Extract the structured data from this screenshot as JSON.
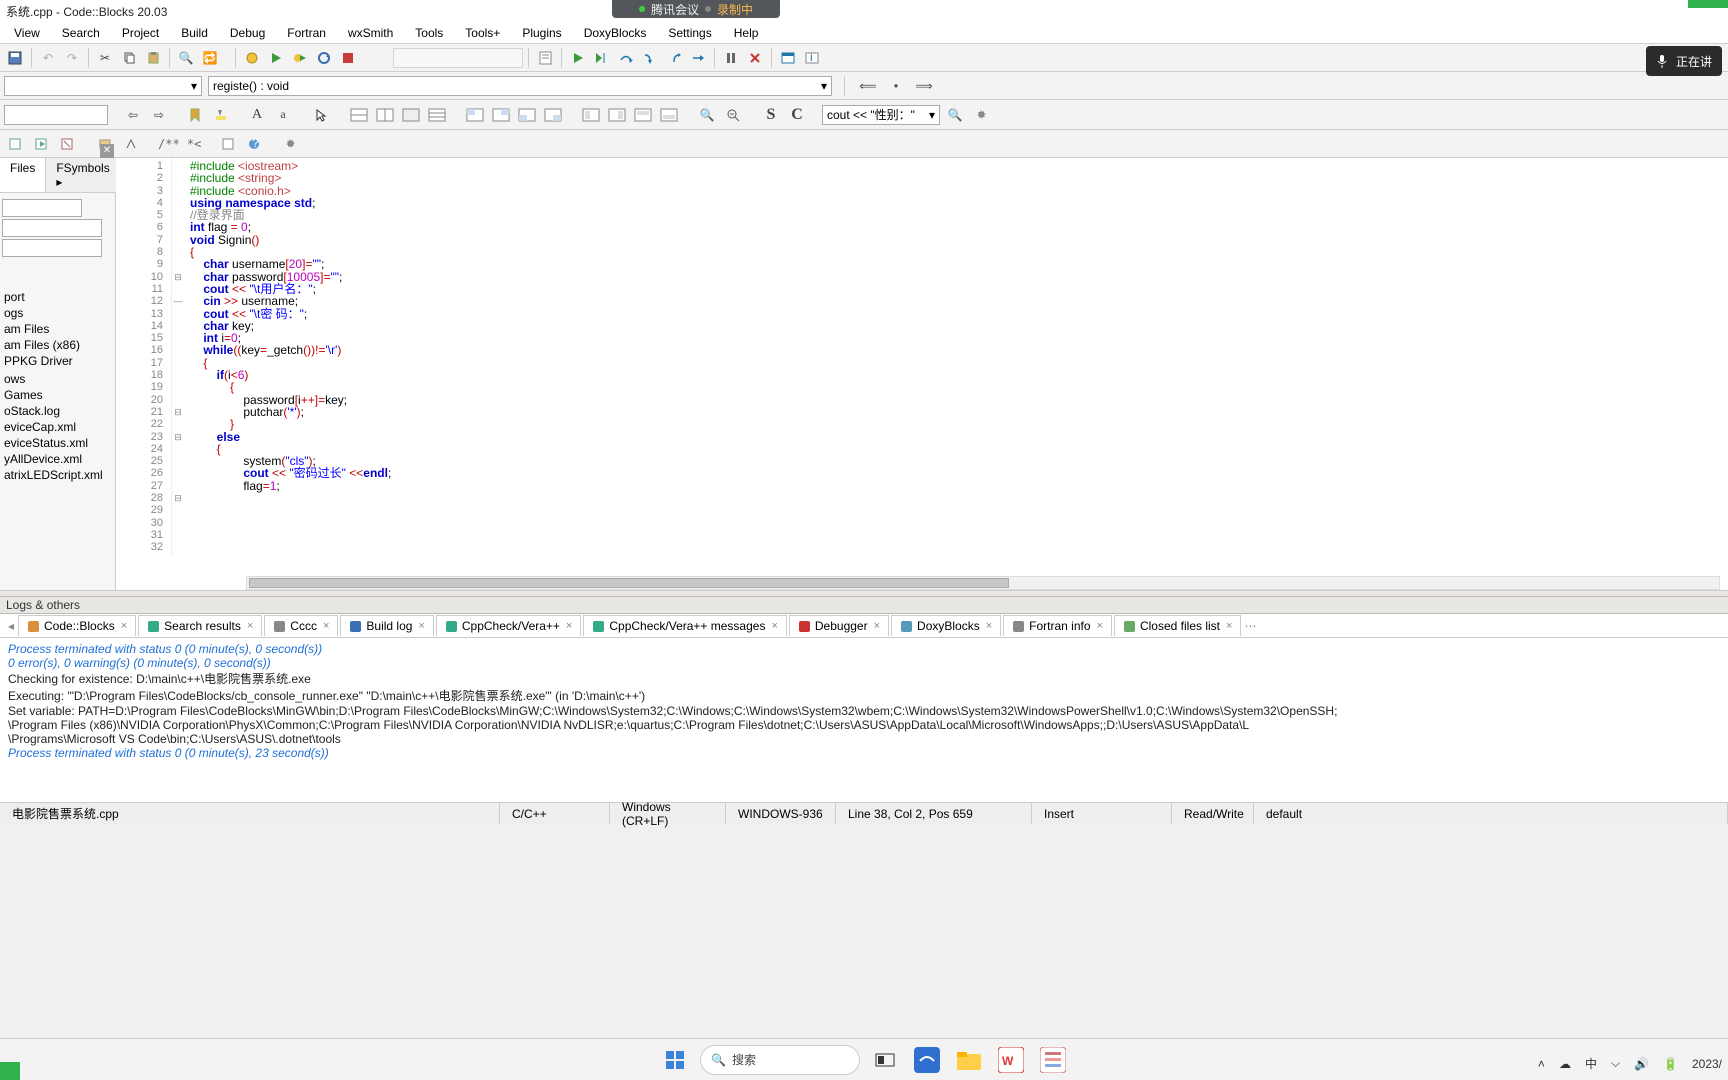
{
  "window_title": "系统.cpp - Code::Blocks 20.03",
  "top_pill": {
    "text1": "腾讯会议",
    "text2": "录制中"
  },
  "rec_pill_text": "正在讲",
  "menu": [
    "View",
    "Search",
    "Project",
    "Build",
    "Debug",
    "Fortran",
    "wxSmith",
    "Tools",
    "Tools+",
    "Plugins",
    "DoxyBlocks",
    "Settings",
    "Help"
  ],
  "target_combo": "registe() : void",
  "search_combo": "cout << \"性别：\"",
  "comment_token": "/** *<",
  "side_tabs": [
    "Files",
    "FSymbols"
  ],
  "file_tree": [
    "port",
    "ogs",
    "am Files",
    "am Files (x86)",
    "PPKG Driver",
    "",
    "ows",
    "Games",
    "oStack.log",
    "eviceCap.xml",
    "eviceStatus.xml",
    "yAllDevice.xml",
    "atrixLEDScript.xml"
  ],
  "line_count": 32,
  "fold_markers": {
    "10": "⊟",
    "12": "—",
    "21": "⊟",
    "23": "⊟",
    "28": "⊟"
  },
  "code_lines": {
    "1": {
      "pp": "#include ",
      "inc": "<iostream>"
    },
    "2": {
      "pp": "#include ",
      "inc": "<string>"
    },
    "3": {
      "pp": "#include ",
      "inc": "<conio.h>"
    },
    "4": {
      "raw": "<span class='kw'>using</span> <span class='kw'>namespace</span> <span class='kw'>std</span>;"
    },
    "5": {
      "cmt": "//登录界面"
    },
    "6": {
      "raw": ""
    },
    "7": {
      "raw": "<span class='kw'>int</span> flag <span class='op'>=</span> <span class='num'>0</span>;"
    },
    "8": {
      "raw": ""
    },
    "9": {
      "raw": ""
    },
    "10": {
      "raw": "<span class='kw'>void</span> Signin<span class='op'>()</span>"
    },
    "11": {
      "raw": "<span class='op'>{</span>"
    },
    "12": {
      "raw": "    <span class='kw'>char</span> username<span class='op'>[</span><span class='num'>20</span><span class='op'>]=</span><span class='str'>\"\"</span>;"
    },
    "13": {
      "raw": "    <span class='kw'>char</span> password<span class='op'>[</span><span class='num'>10005</span><span class='op'>]=</span><span class='str'>\"\"</span>;"
    },
    "14": {
      "raw": "    <span class='kw'>cout</span> <span class='op'>&lt;&lt;</span> <span class='str'>\"\\t用户名：\"</span>;"
    },
    "15": {
      "raw": "    <span class='kw'>cin</span> <span class='op'>&gt;&gt;</span> username;"
    },
    "16": {
      "raw": "    <span class='kw'>cout</span> <span class='op'>&lt;&lt;</span> <span class='str'>\"\\t密 码：\"</span>;"
    },
    "17": {
      "raw": "    <span class='kw'>char</span> key;"
    },
    "18": {
      "raw": "    <span class='kw'>int</span> i<span class='op'>=</span><span class='num'>0</span>;"
    },
    "19": {
      "raw": ""
    },
    "20": {
      "raw": "    <span class='kw'>while</span><span class='op'>((</span>key<span class='op'>=</span>_getch<span class='op'>())!=</span><span class='str'>'\\r'</span><span class='op'>)</span>"
    },
    "21": {
      "raw": "    <span class='op'>{</span>"
    },
    "22": {
      "raw": "        <span class='kw'>if</span><span class='op'>(</span>i<span class='op'>&lt;</span><span class='num'>6</span><span class='op'>)</span>"
    },
    "23": {
      "raw": "            <span class='op'>{</span>"
    },
    "24": {
      "raw": "                password<span class='op'>[</span>i<span class='op'>++]=</span>key;"
    },
    "25": {
      "raw": "                putchar<span class='op'>(</span><span class='str'>'*'</span><span class='op'>)</span>;"
    },
    "26": {
      "raw": "            <span class='op'>}</span>"
    },
    "27": {
      "raw": "        <span class='kw'>else</span>"
    },
    "28": {
      "raw": "        <span class='op'>{</span>"
    },
    "29": {
      "raw": "                system<span class='op'>(</span><span class='str'>\"cls\"</span><span class='op'>)</span>;"
    },
    "30": {
      "raw": "                <span class='kw'>cout</span> <span class='op'>&lt;&lt;</span> <span class='str'>\"密码过长\"</span> <span class='op'>&lt;&lt;</span><span class='kw'>endl</span>;"
    },
    "31": {
      "raw": "                flag<span class='op'>=</span><span class='num'>1</span>;"
    },
    "32": {
      "raw": ""
    }
  },
  "logs_title": "Logs & others",
  "log_tabs": [
    "Code::Blocks",
    "Search results",
    "Cccc",
    "Build log",
    "CppCheck/Vera++",
    "CppCheck/Vera++ messages",
    "Debugger",
    "DoxyBlocks",
    "Fortran info",
    "Closed files list"
  ],
  "log_lines": [
    {
      "cls": "ok",
      "t": "Process terminated with status 0 (0 minute(s), 0 second(s))"
    },
    {
      "cls": "ok",
      "t": "0 error(s), 0 warning(s) (0 minute(s), 0 second(s))"
    },
    {
      "cls": "",
      "t": ""
    },
    {
      "cls": "",
      "t": "Checking for existence: D:\\main\\c++\\电影院售票系统.exe"
    },
    {
      "cls": "",
      "t": "Executing: '\"D:\\Program Files\\CodeBlocks/cb_console_runner.exe\" \"D:\\main\\c++\\电影院售票系统.exe\"' (in 'D:\\main\\c++')"
    },
    {
      "cls": "",
      "t": "Set variable: PATH=D:\\Program Files\\CodeBlocks\\MinGW\\bin;D:\\Program Files\\CodeBlocks\\MinGW;C:\\Windows\\System32;C:\\Windows;C:\\Windows\\System32\\wbem;C:\\Windows\\System32\\WindowsPowerShell\\v1.0;C:\\Windows\\System32\\OpenSSH;"
    },
    {
      "cls": "",
      "t": "\\Program Files (x86)\\NVIDIA Corporation\\PhysX\\Common;C:\\Program Files\\NVIDIA Corporation\\NVIDIA NvDLISR;e:\\quartus;C:\\Program Files\\dotnet;C:\\Users\\ASUS\\AppData\\Local\\Microsoft\\WindowsApps;;D:\\Users\\ASUS\\AppData\\L"
    },
    {
      "cls": "",
      "t": "\\Programs\\Microsoft VS Code\\bin;C:\\Users\\ASUS\\.dotnet\\tools"
    },
    {
      "cls": "ok",
      "t": "Process terminated with status 0 (0 minute(s), 23 second(s))"
    }
  ],
  "status": {
    "file": "电影院售票系统.cpp",
    "lang": "C/C++",
    "eol": "Windows (CR+LF)",
    "enc": "WINDOWS-936",
    "pos": "Line 38, Col 2, Pos 659",
    "ins": "Insert",
    "rw": "Read/Write",
    "prof": "default"
  },
  "taskbar_search": "搜索",
  "tray": {
    "ime": "中",
    "date": "2023/"
  },
  "colors": {
    "green": "#2fb24c"
  }
}
